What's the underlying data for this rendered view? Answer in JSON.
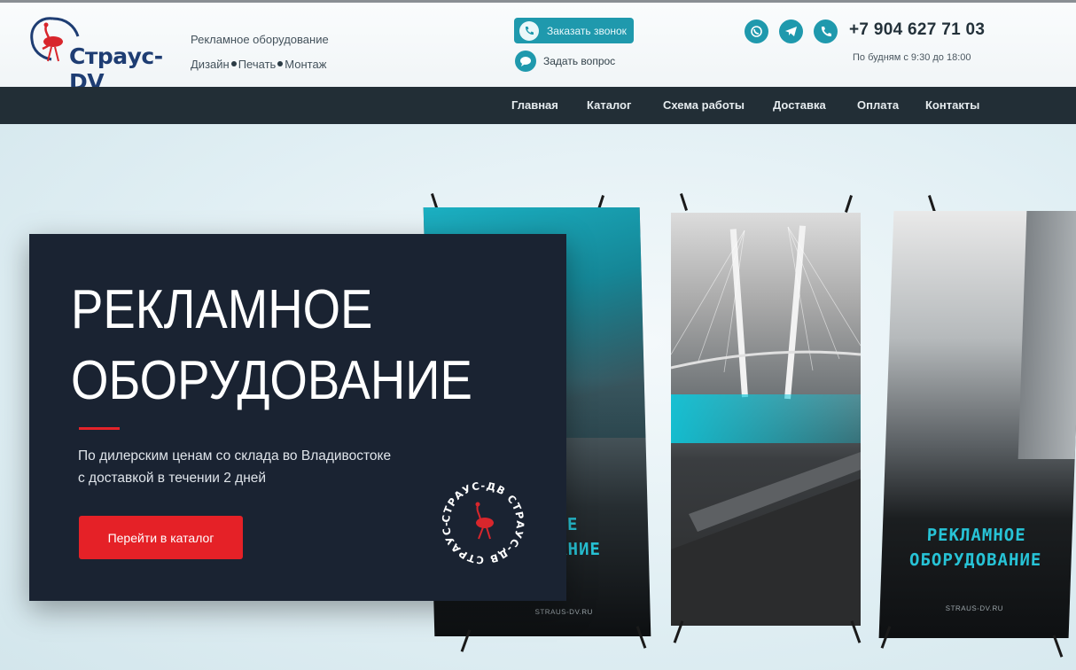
{
  "header": {
    "brand": "Страус-DV",
    "tagline_top": "Рекламное оборудование",
    "tagline_services": [
      "Дизайн",
      "Печать",
      "Монтаж"
    ],
    "call_button": "Заказать звонок",
    "ask_question": "Задать вопрос",
    "phone": "+7 904 627 71 03",
    "hours": "По будням с 9:30 до 18:00",
    "social_icons": [
      "whatsapp-icon",
      "telegram-icon",
      "viber-icon"
    ],
    "accent_color": "#1f99ad"
  },
  "nav": {
    "items": [
      "Главная",
      "Каталог",
      "Схема работы",
      "Доставка",
      "Оплата",
      "Контакты"
    ]
  },
  "hero": {
    "title_line1": "РЕКЛАМНОЕ",
    "title_line2": "ОБОРУДОВАНИЕ",
    "subtitle_line1": "По дилерским ценам со склада во Владивостоке",
    "subtitle_line2": "с доставкой в течении 2 дней",
    "cta": "Перейти в каталог",
    "cta_color": "#e52127",
    "seal_text": "СТРАУС-ДВ СТРАУС-ДВ СТРАУС-ДВ",
    "banners": [
      {
        "title_line1": "НОЕ",
        "title_line2": "ВАНИЕ",
        "url": "STRAUS-DV.RU"
      },
      {
        "title_line1": "",
        "title_line2": "",
        "url": ""
      },
      {
        "title_line1": "РЕКЛАМНОЕ",
        "title_line2": "ОБОРУДОВАНИЕ",
        "url": "STRAUS-DV.RU"
      }
    ]
  }
}
